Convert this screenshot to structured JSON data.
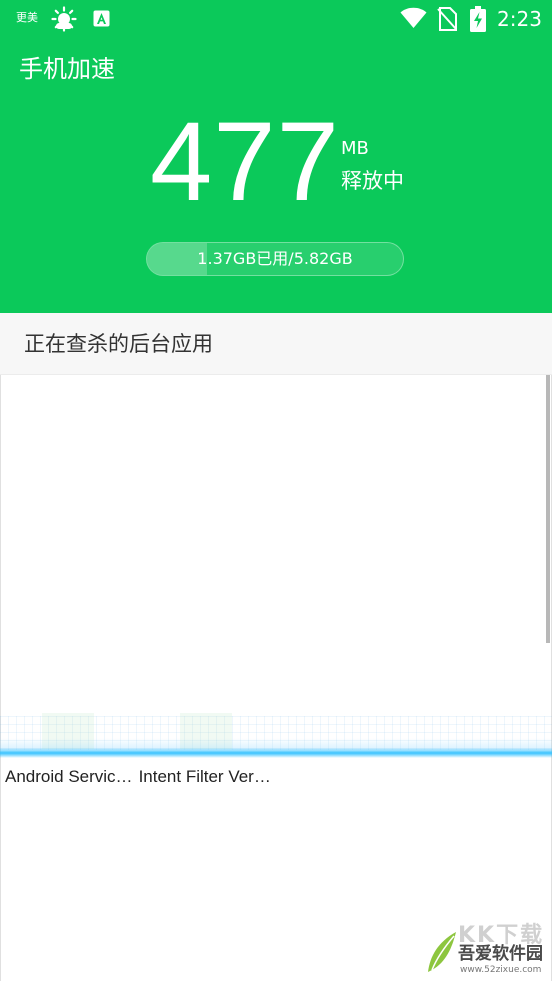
{
  "status_bar": {
    "carrier": "更美",
    "time": "2:23",
    "icons": [
      "weather-icon",
      "app-notification-icon",
      "wifi-icon",
      "no-sim-icon",
      "battery-charging-icon"
    ]
  },
  "header": {
    "title": "手机加速",
    "freed_amount": "477",
    "freed_unit": "MB",
    "freed_status": "释放中",
    "memory_usage_text": "1.37GB已用/5.82GB",
    "memory_used_fraction": 0.235
  },
  "section": {
    "title": "正在查杀的后台应用"
  },
  "apps": [
    {
      "name": "Android Servic…"
    },
    {
      "name": "Intent Filter Ver…"
    }
  ],
  "watermark": {
    "top_text": "KK下载",
    "name": "吾爱软件园",
    "url": "www.52zixue.com"
  },
  "colors": {
    "brand_green": "#0bc95a",
    "scan_blue": "#28beff",
    "section_bg": "#f7f7f7"
  }
}
